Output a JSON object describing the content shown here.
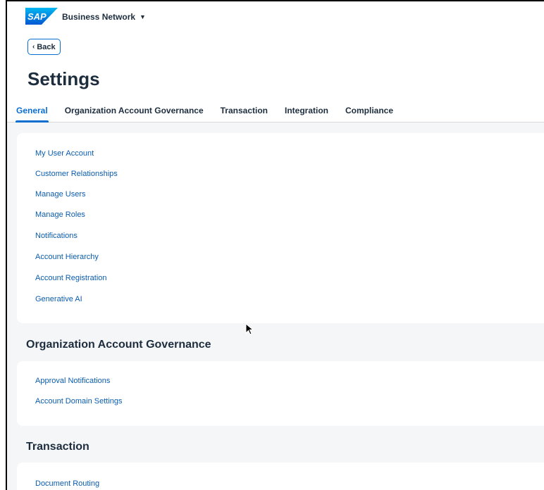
{
  "shell": {
    "logo_text": "SAP",
    "product_name": "Business Network",
    "product_caret": "▼"
  },
  "header": {
    "back_label": "Back",
    "back_chevron": "‹",
    "title": "Settings"
  },
  "tabs": [
    {
      "label": "General",
      "active": true
    },
    {
      "label": "Organization Account Governance",
      "active": false
    },
    {
      "label": "Transaction",
      "active": false
    },
    {
      "label": "Integration",
      "active": false
    },
    {
      "label": "Compliance",
      "active": false
    }
  ],
  "general": {
    "links": [
      "My User Account",
      "Customer Relationships",
      "Manage Users",
      "Manage Roles",
      "Notifications",
      "Account Hierarchy",
      "Account Registration",
      "Generative AI"
    ]
  },
  "org_governance": {
    "title": "Organization Account Governance",
    "links": [
      "Approval Notifications",
      "Account Domain Settings"
    ]
  },
  "transaction": {
    "title": "Transaction",
    "links": [
      "Document Routing"
    ]
  },
  "colors": {
    "brand_blue": "#0a6ed1",
    "link_blue": "#0a5cae",
    "text": "#1d2d3e",
    "background": "#f5f6f7"
  }
}
